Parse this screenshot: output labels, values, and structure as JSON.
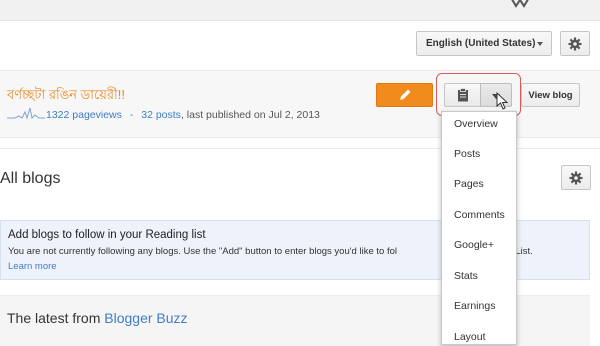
{
  "header": {
    "language_label": "English (United States)"
  },
  "blog": {
    "title": "বর্ণচ্ছটা রঙিন ডায়েরী!!",
    "pageviews": "1322 pageviews",
    "dash": "-",
    "posts": "32 posts",
    "last_published": ", last published on Jul 2, 2013",
    "view_blog_label": "View blog"
  },
  "section": {
    "all_blogs": "All blogs"
  },
  "reading_list": {
    "title": "Add blogs to follow in your Reading list",
    "text": "You are not currently following any blogs. Use the \"Add\" button to enter blogs you'd like to fol",
    "text_tail": "ing List.",
    "link": "Learn more"
  },
  "latest": {
    "prefix": "The latest from",
    "source": "Blogger Buzz"
  },
  "menu": {
    "items": [
      "Overview",
      "Posts",
      "Pages",
      "Comments",
      "Google+",
      "Stats",
      "Earnings",
      "Layout"
    ]
  },
  "colors": {
    "accent_orange": "#f28b1e",
    "link_blue": "#3f7dc4",
    "highlight_red": "#d85b5b"
  }
}
